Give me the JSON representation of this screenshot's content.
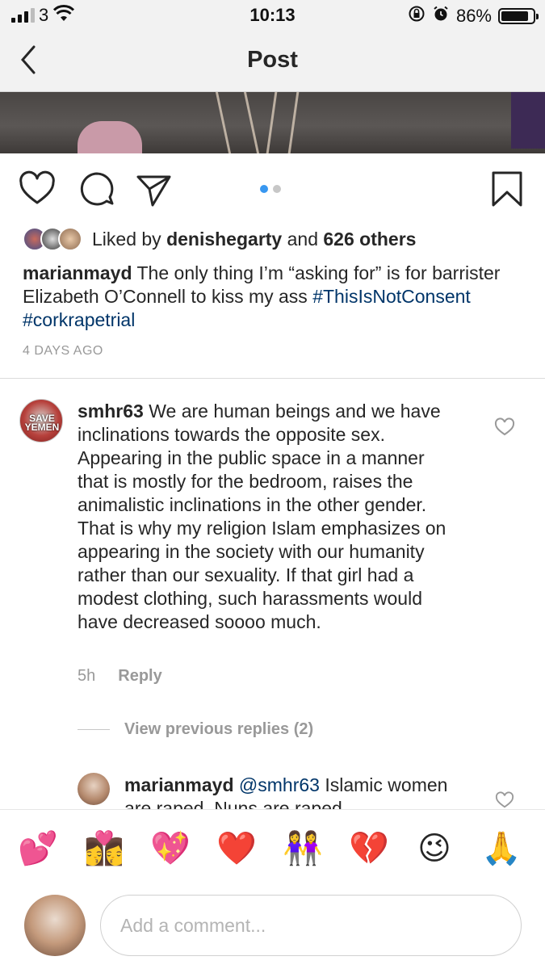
{
  "status_bar": {
    "carrier": "3",
    "time": "10:13",
    "battery": "86%",
    "battery_level": 0.86
  },
  "nav": {
    "title": "Post",
    "back_icon": "chevron-left-icon"
  },
  "actions": {
    "icons": [
      "heart-icon",
      "comment-icon",
      "share-icon",
      "bookmark-icon"
    ],
    "carousel_total": 2,
    "carousel_active": 1
  },
  "likes": {
    "prefix": "Liked by",
    "user": "denishegarty",
    "joiner": "and",
    "others": "626 others"
  },
  "caption": {
    "username": "marianmayd",
    "text": "The only thing I’m “asking for” is for barrister Elizabeth O’Connell to kiss my ass",
    "hashtag1": "#ThisIsNotConsent",
    "hashtag2": "#corkrapetrial",
    "time_ago": "4 DAYS AGO"
  },
  "comment": {
    "username": "smhr63",
    "text": "We are human beings and we have inclinations towards the opposite sex. Appearing in the public space in a manner that is mostly for the bedroom, raises the animalistic inclinations in the other gender. That is why my religion Islam emphasizes on appearing in the society with our humanity rather than our sexuality. If that girl had a modest clothing, such harassments would have decreased soooo much.",
    "avatar_text_1": "SAVE",
    "avatar_text_2": "YEMEN",
    "time": "5h",
    "reply_label": "Reply",
    "view_replies": "View previous replies (2)"
  },
  "reply": {
    "username": "marianmayd",
    "mention": "@smhr63",
    "text": "Islamic women are raped. Nuns are raped."
  },
  "emoji_bar": [
    "💕",
    "👩‍❤️‍💋‍👩",
    "💖",
    "❤️",
    "👭",
    "💔",
    "😉",
    "🙏"
  ],
  "comment_input": {
    "placeholder": "Add a comment..."
  },
  "colors": {
    "link": "#003569",
    "accent_dot": "#3897f0",
    "muted": "#999999"
  }
}
